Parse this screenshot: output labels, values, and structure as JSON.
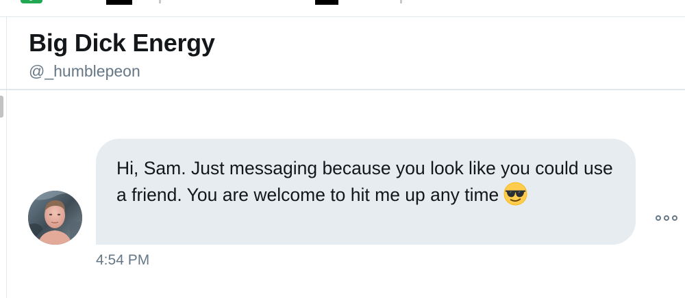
{
  "conversation": {
    "display_name": "Big Dick Energy",
    "handle": "@_humblepeon"
  },
  "message": {
    "text": "Hi, Sam. Just messaging because you look like you could use a friend. You are welcome to hit me up any time",
    "emoji": "smiling-face-with-sunglasses",
    "timestamp": "4:54 PM"
  },
  "icons": {
    "more": "more-horizontal-icon",
    "avatar": "avatar-photo"
  },
  "colors": {
    "bubble_bg": "#e6ecf0",
    "primary_text": "#14171a",
    "secondary_text": "#657786",
    "divider": "#e1e8ed"
  }
}
